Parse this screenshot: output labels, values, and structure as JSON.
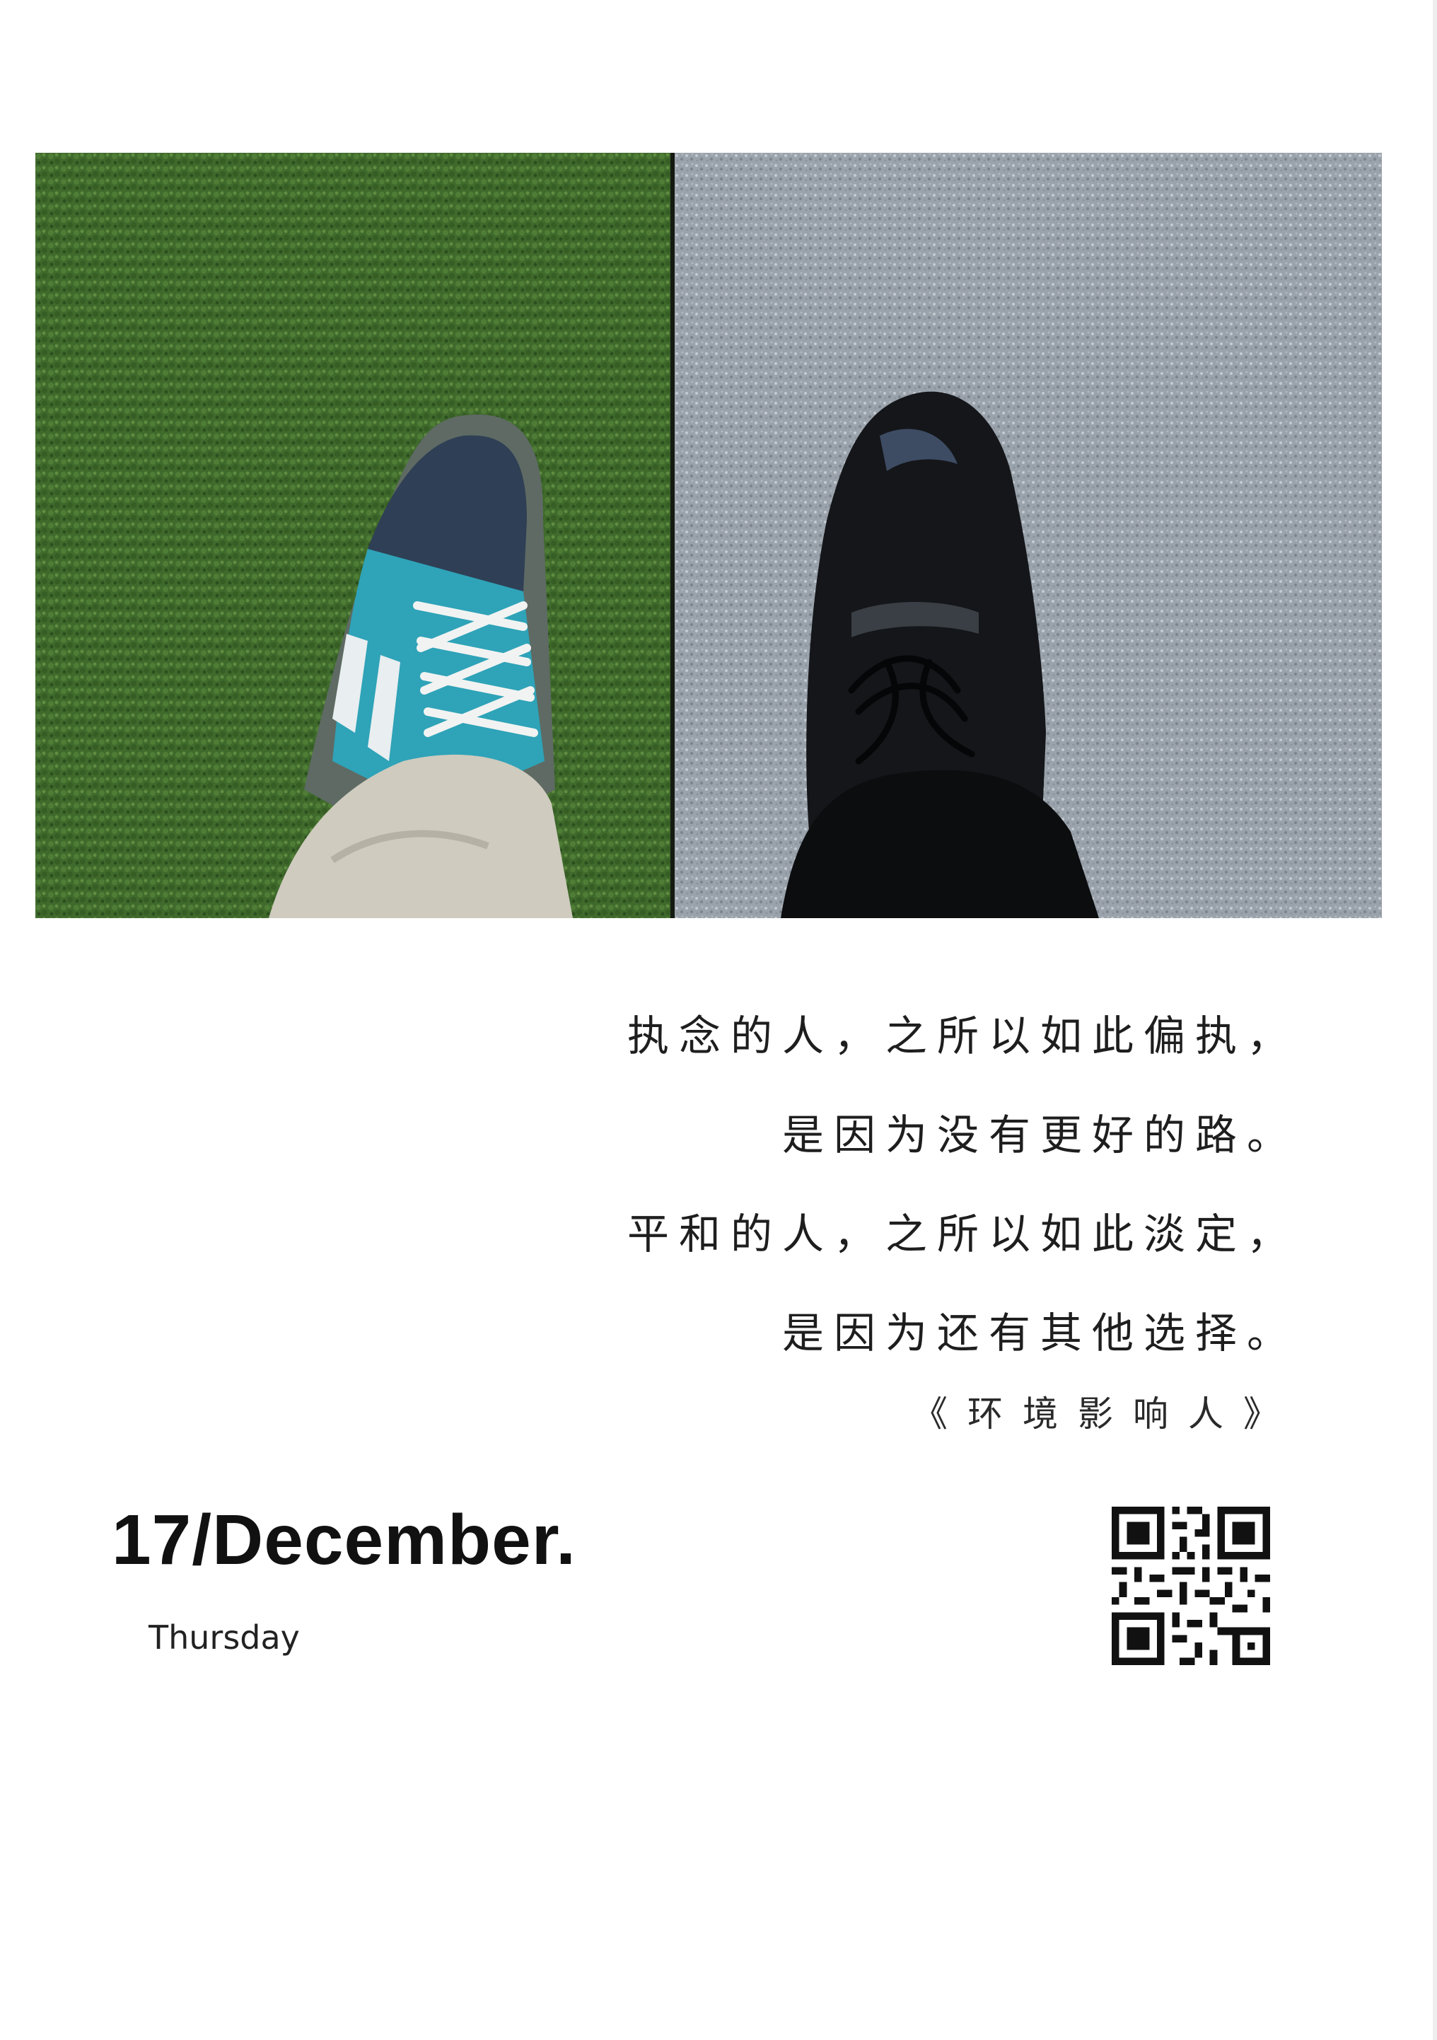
{
  "image": {
    "left_scene": "green grass with blue-and-white sneaker and beige trousers",
    "right_scene": "grey gravel with black leather dress shoe and black trousers"
  },
  "quote": {
    "lines": [
      "执念的人，之所以如此偏执，",
      "是因为没有更好的路。",
      "平和的人，之所以如此淡定，",
      "是因为还有其他选择。"
    ],
    "source": "《环境影响人》"
  },
  "date": {
    "text": "17/December.",
    "weekday": "Thursday"
  },
  "qr_code": {
    "icon": "qr-code-icon"
  }
}
